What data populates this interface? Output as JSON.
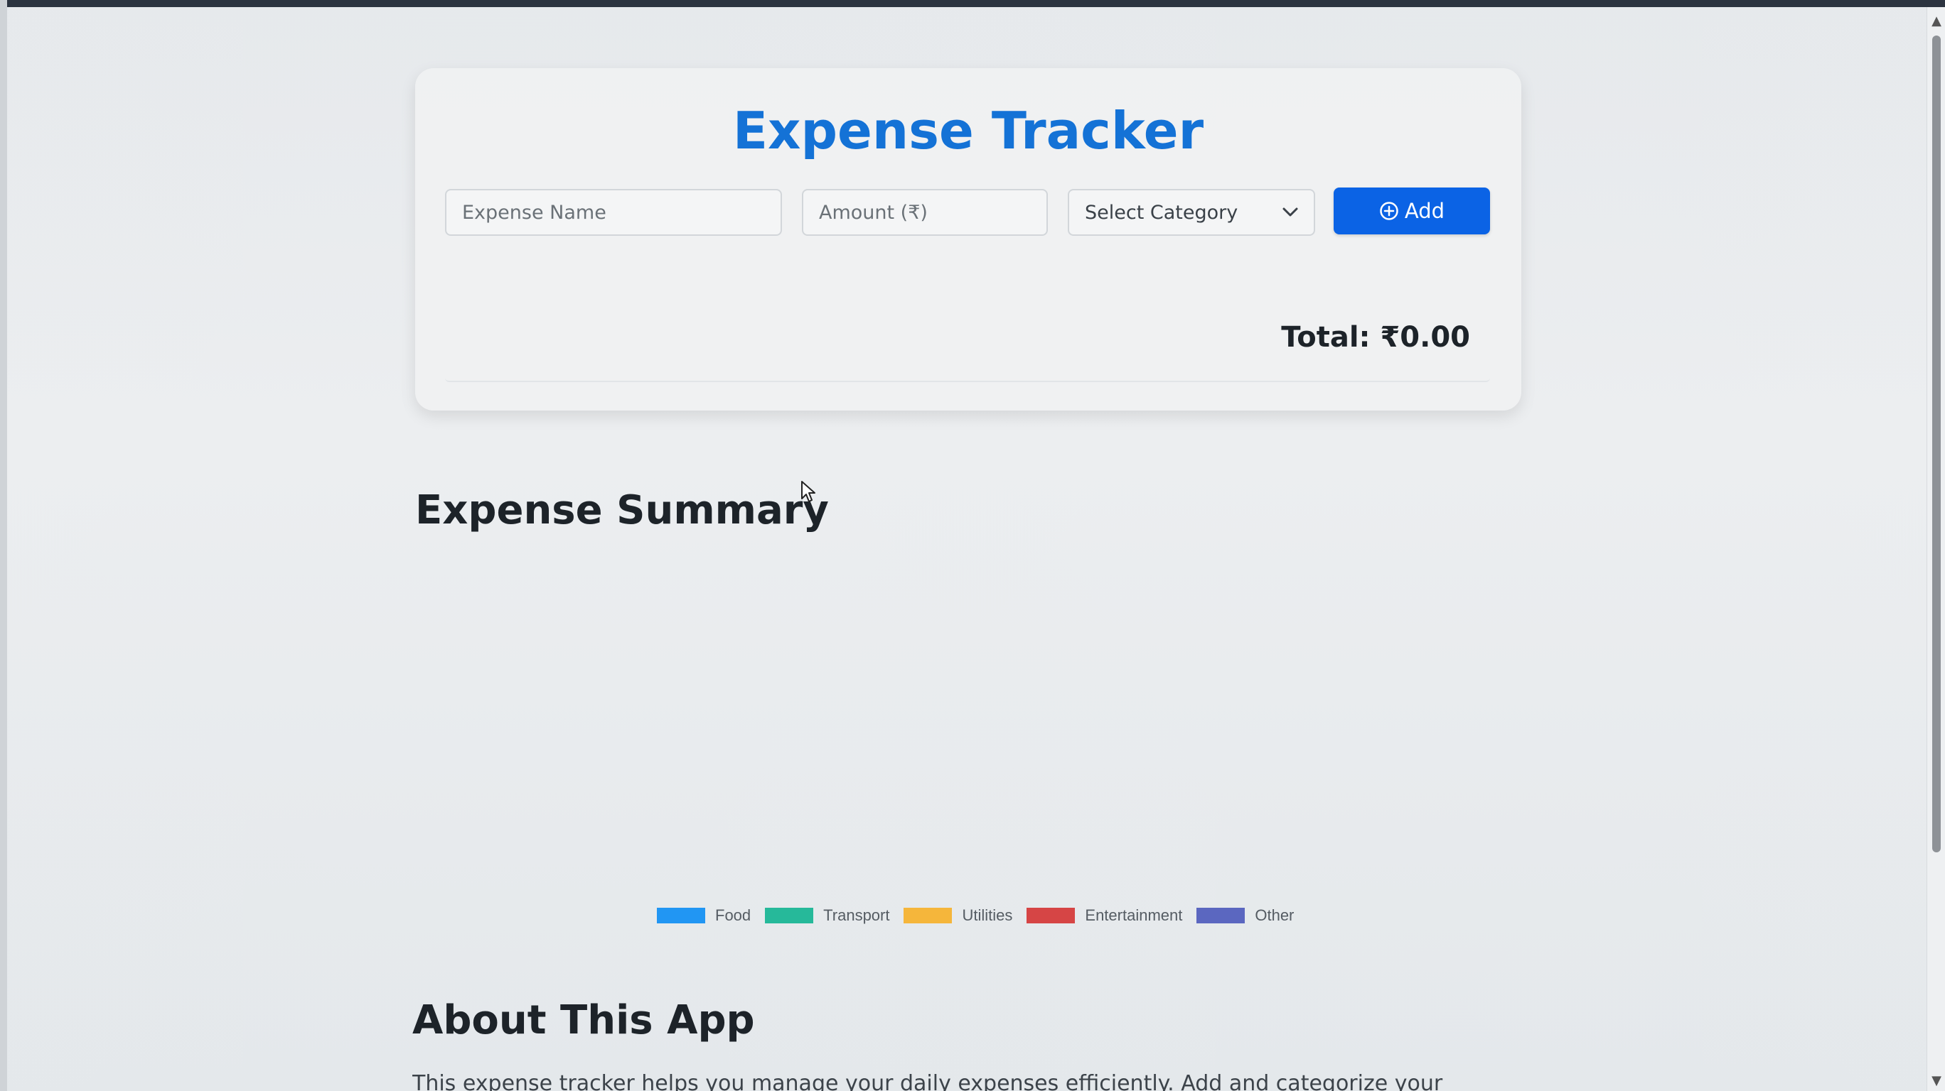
{
  "app": {
    "title": "Expense Tracker"
  },
  "form": {
    "name_placeholder": "Expense Name",
    "amount_placeholder": "Amount (₹)",
    "category_selected": "Select Category",
    "add_label": "Add"
  },
  "totals": {
    "total_text": "Total: ₹0.00"
  },
  "summary": {
    "title": "Expense Summary"
  },
  "chart_data": {
    "type": "pie",
    "categories": [
      "Food",
      "Transport",
      "Utilities",
      "Entertainment",
      "Other"
    ],
    "values": [
      0,
      0,
      0,
      0,
      0
    ],
    "colors": [
      "#2196f3",
      "#26b99a",
      "#f5b63b",
      "#d64545",
      "#5b67c0"
    ],
    "legend_position": "bottom"
  },
  "about": {
    "title": "About This App",
    "text": "This expense tracker helps you manage your daily expenses efficiently. Add and categorize your"
  },
  "icons": {
    "add": "plus-circle-icon",
    "dropdown": "chevron-down-icon",
    "cursor": "mouse-pointer-icon"
  }
}
